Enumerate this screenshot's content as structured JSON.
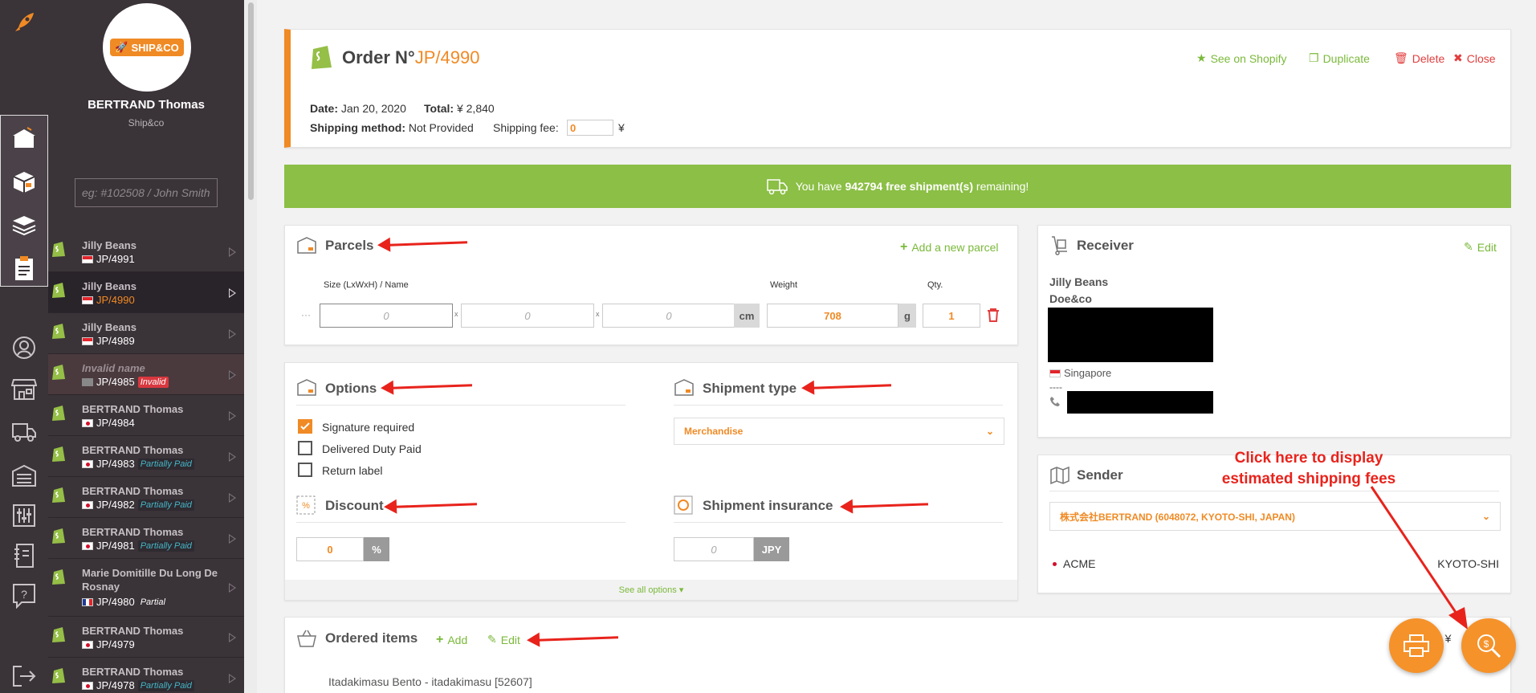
{
  "rail": {
    "icons": [
      "rocket-icon",
      "orders-icon",
      "box-icon",
      "layers-icon",
      "clipboard-icon",
      "user-icon",
      "store-icon",
      "truck-icon",
      "warehouse-icon",
      "sliders-icon",
      "notebook-icon",
      "help-icon",
      "logout-icon"
    ]
  },
  "sidebar": {
    "logo_text": "SHIP&CO",
    "user_name": "BERTRAND Thomas",
    "company": "Ship&co",
    "search_placeholder": "eg: #102508 / John Smith",
    "orders": [
      {
        "name": "Jilly Beans",
        "flag": "sg",
        "id": "JP/4991",
        "badge": ""
      },
      {
        "name": "Jilly Beans",
        "flag": "sg",
        "id": "JP/4990",
        "badge": "",
        "active": true
      },
      {
        "name": "Jilly Beans",
        "flag": "sg",
        "id": "JP/4989",
        "badge": ""
      },
      {
        "name": "Invalid name",
        "flag": "grey",
        "id": "JP/4985",
        "badge": "Invalid"
      },
      {
        "name": "BERTRAND Thomas",
        "flag": "jp",
        "id": "JP/4984",
        "badge": ""
      },
      {
        "name": "BERTRAND Thomas",
        "flag": "jp",
        "id": "JP/4983",
        "badge": "Partially Paid"
      },
      {
        "name": "BERTRAND Thomas",
        "flag": "jp",
        "id": "JP/4982",
        "badge": "Partially Paid"
      },
      {
        "name": "BERTRAND Thomas",
        "flag": "jp",
        "id": "JP/4981",
        "badge": "Partially Paid"
      },
      {
        "name": "Marie Domitille Du Long De Rosnay",
        "flag": "fr",
        "id": "JP/4980",
        "badge": "Partial"
      },
      {
        "name": "BERTRAND Thomas",
        "flag": "jp",
        "id": "JP/4979",
        "badge": ""
      },
      {
        "name": "BERTRAND Thomas",
        "flag": "jp",
        "id": "JP/4978",
        "badge": "Partially Paid"
      }
    ]
  },
  "order": {
    "title_prefix": "Order N°",
    "number": "JP/4990",
    "see_on_shopify": "See on Shopify",
    "duplicate": "Duplicate",
    "delete": "Delete",
    "close": "Close",
    "date_label": "Date:",
    "date": "Jan 20, 2020",
    "total_label": "Total:",
    "total": "¥ 2,840",
    "shipping_method_label": "Shipping method:",
    "shipping_method": "Not Provided",
    "shipping_fee_label": "Shipping fee:",
    "shipping_fee": "0",
    "currency_symbol": "¥"
  },
  "banner": {
    "prefix": "You have ",
    "count": "942794 free shipment(s)",
    "suffix": " remaining!"
  },
  "parcels": {
    "title": "Parcels",
    "add": "Add a new parcel",
    "col_size": "Size (LxWxH) / Name",
    "col_weight": "Weight",
    "col_qty": "Qty.",
    "drag": "···",
    "dim_l": "0",
    "dim_w": "0",
    "dim_h": "0",
    "x": "x",
    "dim_unit": "cm",
    "weight": "708",
    "weight_unit": "g",
    "qty": "1"
  },
  "options": {
    "title": "Options",
    "items": [
      {
        "label": "Signature required",
        "checked": true
      },
      {
        "label": "Delivered Duty Paid",
        "checked": false
      },
      {
        "label": "Return label",
        "checked": false
      }
    ],
    "shipment_type_title": "Shipment type",
    "shipment_type_value": "Merchandise",
    "discount_title": "Discount",
    "discount_value": "0",
    "discount_unit": "%",
    "insurance_title": "Shipment insurance",
    "insurance_placeholder": "0",
    "insurance_unit": "JPY",
    "see_all": "See all options ▾"
  },
  "receiver": {
    "title": "Receiver",
    "edit": "Edit",
    "name": "Jilly Beans",
    "company": "Doe&co",
    "country": "Singapore",
    "dashes": "----"
  },
  "sender": {
    "title": "Sender",
    "selected": "株式会社BERTRAND (6048072, KYOTO-SHI, JAPAN)",
    "name": "ACME",
    "city": "KYOTO-SHI"
  },
  "items": {
    "title": "Ordered items",
    "add": "Add",
    "edit": "Edit",
    "first_item": "Itadakimasu Bento - itadakimasu [52607]",
    "total_fragment": "tal: ¥"
  },
  "annotation": {
    "line1": "Click here to display",
    "line2": "estimated shipping fees"
  },
  "colors": {
    "accent": "#f08a24",
    "green": "#7ab93a",
    "red": "#e23d3d",
    "banner": "#8bbf45",
    "sidebar": "#3a3338"
  }
}
